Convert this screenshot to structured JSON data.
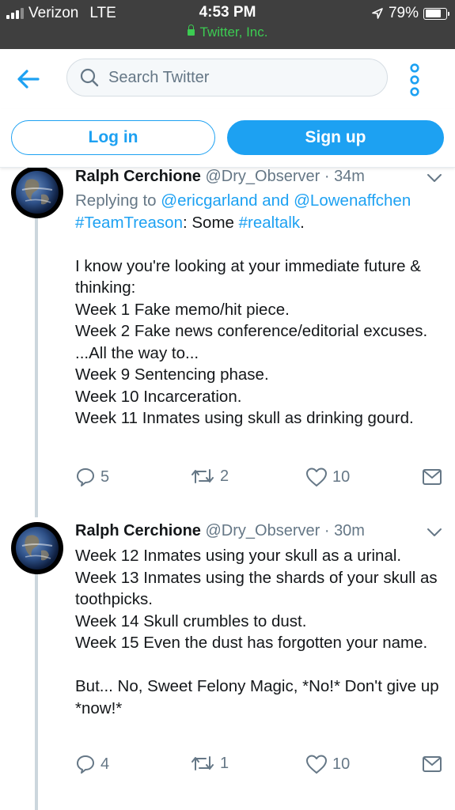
{
  "status_bar": {
    "carrier": "Verizon",
    "network": "LTE",
    "time": "4:53 PM",
    "site": "Twitter, Inc.",
    "battery": "79%",
    "battery_level": 0.79
  },
  "nav": {
    "search_placeholder": "Search Twitter"
  },
  "auth": {
    "login_label": "Log in",
    "signup_label": "Sign up"
  },
  "tweets": [
    {
      "name": "Ralph Cerchione",
      "handle": "@Dry_Observer",
      "separator": "·",
      "time": "34m",
      "replying_prefix": "Replying to",
      "replying_user1": "@ericgarland",
      "replying_and": "and",
      "replying_user2": "@Lowenaffchen",
      "hashtag1": "#TeamTreason",
      "text_mid": ": Some",
      "hashtag2": "#realtalk",
      "text_end": ".",
      "lines": [
        "I know you're looking at your immediate future & thinking:",
        "Week 1 Fake memo/hit piece.",
        "Week 2 Fake news conference/editorial excuses.",
        "...All the way to...",
        "Week 9 Sentencing phase.",
        "Week 10 Incarceration.",
        "Week 11 Inmates using skull as drinking gourd."
      ],
      "replies": "5",
      "retweets": "2",
      "likes": "10"
    },
    {
      "name": "Ralph Cerchione",
      "handle": "@Dry_Observer",
      "separator": "·",
      "time": "30m",
      "lines": [
        "Week 12 Inmates using your skull as a urinal.",
        "Week 13 Inmates using the shards of your skull as toothpicks.",
        "Week 14 Skull crumbles to dust.",
        "Week 15 Even the dust has forgotten your name.",
        "But... No, Sweet Felony Magic, *No!*  Don't give up *now!*"
      ],
      "replies": "4",
      "retweets": "1",
      "likes": "10"
    }
  ],
  "colors": {
    "accent": "#1da1f2",
    "secondary_text": "#657786",
    "status_bar_bg": "#3f3f3f",
    "secure_green": "#3ccc52"
  },
  "icons": [
    "signal-icon",
    "lock-icon",
    "location-arrow-icon",
    "battery-icon",
    "back-arrow-icon",
    "search-icon",
    "more-icon",
    "chevron-down-icon",
    "reply-icon",
    "retweet-icon",
    "like-icon",
    "message-icon"
  ]
}
